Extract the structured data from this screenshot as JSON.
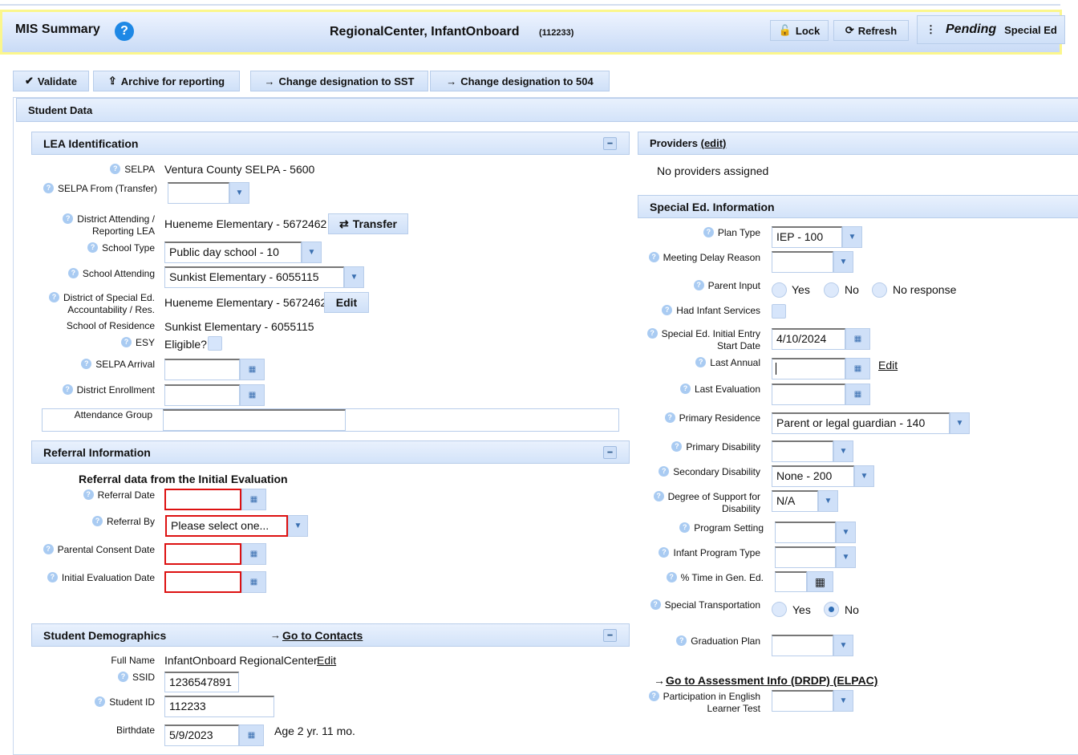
{
  "header": {
    "title": "MIS Summary",
    "student_name": "RegionalCenter, InfantOnboard",
    "student_id": "(112233)",
    "lock": "Lock",
    "refresh": "Refresh",
    "status": "Pending",
    "program": "Special Ed"
  },
  "actions": {
    "validate": "Validate",
    "archive": "Archive for reporting",
    "to_sst": "Change designation to SST",
    "to_504": "Change designation to 504"
  },
  "student_data": "Student Data",
  "lea": {
    "title": "LEA Identification",
    "selpa_label": "SELPA",
    "selpa": "Ventura County SELPA - 5600",
    "selpa_from_label": "SELPA From (Transfer)",
    "selpa_from": "",
    "district_label": "District Attending / Reporting LEA",
    "district": "Hueneme Elementary - 5672462",
    "transfer": "Transfer",
    "school_type_label": "School Type",
    "school_type": "Public day school - 10",
    "school_att_label": "School Attending",
    "school_att": "Sunkist Elementary - 6055115",
    "dsea_label": "District of Special Ed. Accountability / Res.",
    "dsea": "Hueneme Elementary - 5672462",
    "edit": "Edit",
    "residence_label": "School of Residence",
    "residence": "Sunkist Elementary - 6055115",
    "esy_label": "ESY",
    "esy": "Eligible?",
    "arrival_label": "SELPA Arrival",
    "arrival": "",
    "enroll_label": "District Enrollment",
    "enroll": "",
    "attendance_label": "Attendance Group",
    "attendance": ""
  },
  "referral": {
    "title": "Referral Information",
    "subtitle": "Referral data from the Initial Evaluation",
    "date_label": "Referral Date",
    "date": "",
    "by_label": "Referral By",
    "by": "Please select one...",
    "consent_label": "Parental Consent Date",
    "consent": "",
    "eval_label": "Initial Evaluation Date",
    "eval": ""
  },
  "demo": {
    "title": "Student Demographics",
    "contacts": "Go to Contacts",
    "name_label": "Full Name",
    "name": "InfantOnboard RegionalCenter",
    "edit": "Edit",
    "ssid_label": "SSID",
    "ssid": "1236547891",
    "sid_label": "Student ID",
    "sid": "112233",
    "birth_label": "Birthdate",
    "birth": "5/9/2023",
    "age": "Age 2 yr. 11 mo."
  },
  "providers": {
    "title": "Providers",
    "edit": "(edit)",
    "none": "No providers assigned"
  },
  "sped": {
    "title": "Special Ed. Information",
    "plan_label": "Plan Type",
    "plan": "IEP - 100",
    "delay_label": "Meeting Delay Reason",
    "delay": "",
    "parent_label": "Parent Input",
    "yes": "Yes",
    "no": "No",
    "noresp": "No response",
    "infant_label": "Had Infant Services",
    "entry_label": "Special Ed. Initial Entry Start Date",
    "entry": "4/10/2024",
    "annual_label": "Last Annual",
    "annual": "",
    "annual_edit": "Edit",
    "lasteval_label": "Last Evaluation",
    "lasteval": "",
    "resid_label": "Primary Residence",
    "resid": "Parent or legal guardian - 140",
    "pdis_label": "Primary Disability",
    "pdis": "",
    "sdis_label": "Secondary Disability",
    "sdis": "None - 200",
    "support_label": "Degree of Support for Disability",
    "support": "N/A",
    "setting_label": "Program Setting",
    "setting": "",
    "infprog_label": "Infant Program Type",
    "infprog": "",
    "gened_label": "% Time in Gen. Ed.",
    "gened": "",
    "transport_label": "Special Transportation",
    "transport": "No",
    "grad_label": "Graduation Plan",
    "grad": "",
    "assess": "Go to Assessment Info (DRDP) (ELPAC)",
    "elt_label": "Participation in English Learner Test",
    "elt": ""
  }
}
